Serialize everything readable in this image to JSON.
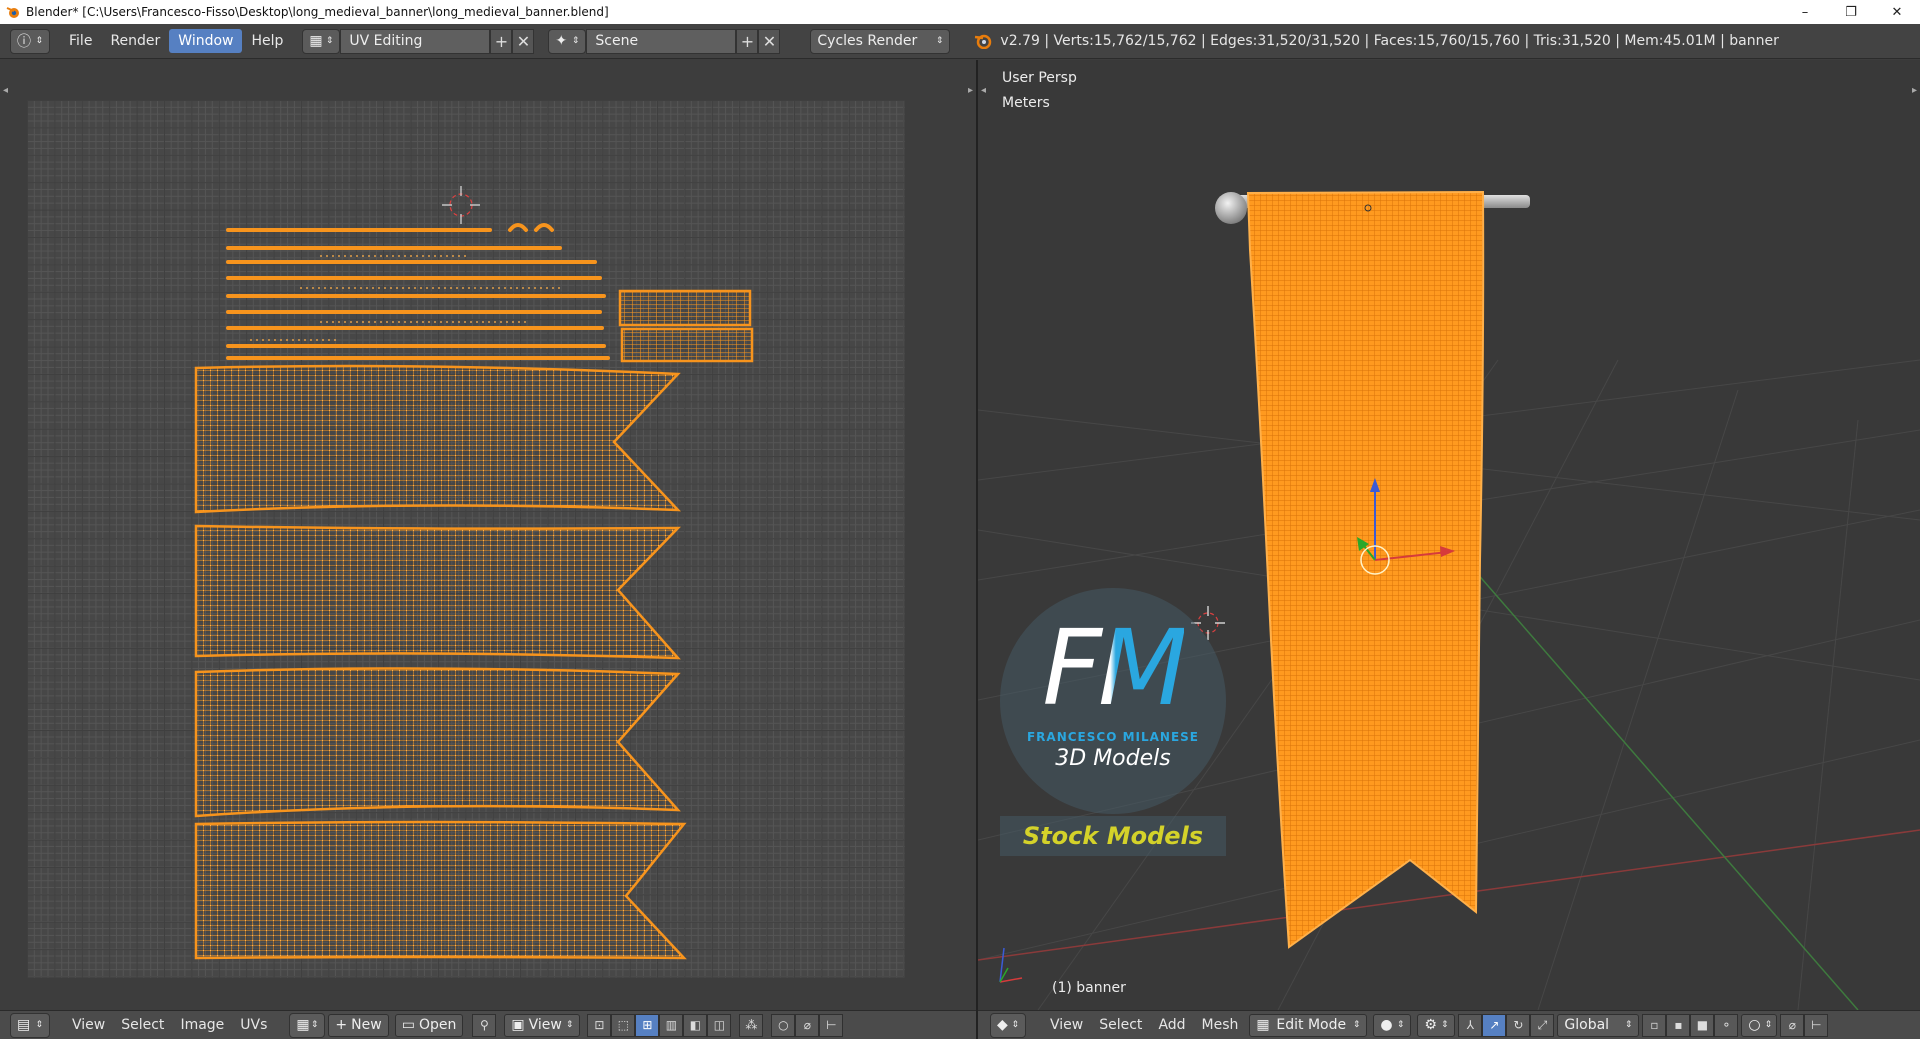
{
  "window": {
    "title": "Blender* [C:\\Users\\Francesco-Fisso\\Desktop\\long_medieval_banner\\long_medieval_banner.blend]",
    "minimize": "–",
    "maximize": "❐",
    "close": "✕"
  },
  "info_header": {
    "menus": [
      "File",
      "Render",
      "Window",
      "Help"
    ],
    "active_menu": "Window",
    "screen_layout": "UV Editing",
    "scene": "Scene",
    "render_engine": "Cycles Render",
    "stats": "v2.79 | Verts:15,762/15,762 | Edges:31,520/31,520 | Faces:15,760/15,760 | Tris:31,520 | Mem:45.01M | banner"
  },
  "uv_editor": {
    "footer": {
      "menus": [
        "View",
        "Select",
        "Image",
        "UVs"
      ],
      "new_label": "New",
      "open_label": "Open",
      "view_label": "View"
    }
  },
  "viewport": {
    "view_name": "User Persp",
    "units": "Meters",
    "object_label": "(1) banner",
    "footer": {
      "menus": [
        "View",
        "Select",
        "Add",
        "Mesh"
      ],
      "mode": "Edit Mode",
      "orientation": "Global"
    }
  },
  "watermark": {
    "logo_letters": "FM",
    "brand": "FRANCESCO MILANESE",
    "tagline": "3D Models",
    "stock_label": "Stock Models"
  },
  "colors": {
    "accent": "#5680c2",
    "uv_orange": "#f7941d",
    "mesh_orange": "#ff9a1f",
    "grid_bg": "#474747",
    "watermark_yellow": "#d4d22a",
    "watermark_blue": "#2aa7e0"
  }
}
